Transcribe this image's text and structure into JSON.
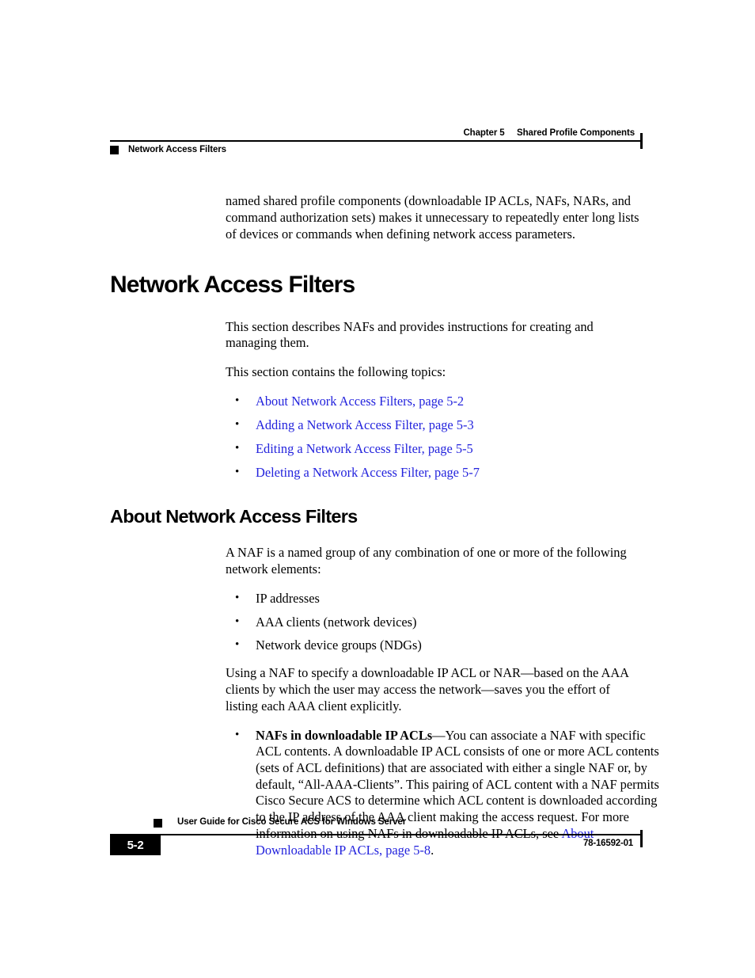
{
  "header": {
    "chapter": "Chapter 5     Shared Profile Components",
    "subtitle": "Network Access Filters"
  },
  "body": {
    "intro_paragraph": "named shared profile components (downloadable IP ACLs, NAFs, NARs, and command authorization sets) makes it unnecessary to repeatedly enter long lists of devices or commands when defining network access parameters.",
    "section_title": "Network Access Filters",
    "section_para_1": "This section describes NAFs and provides instructions for creating and managing them.",
    "section_para_2": "This section contains the following topics:",
    "topic_links": [
      "About Network Access Filters, page 5-2",
      "Adding a Network Access Filter, page 5-3",
      "Editing a Network Access Filter, page 5-5",
      "Deleting a Network Access Filter, page 5-7"
    ],
    "subsection_title": "About Network Access Filters",
    "subsection_para_1": "A NAF is a named group of any combination of one or more of the following network elements:",
    "element_bullets": [
      "IP addresses",
      "AAA clients (network devices)",
      "Network device groups (NDGs)"
    ],
    "subsection_para_2": "Using a NAF to specify a downloadable IP ACL or NAR—based on the AAA clients by which the user may access the network—saves you the effort of listing each AAA client explicitly.",
    "naf_bullet": {
      "bold_lead": "NAFs in downloadable IP ACLs",
      "text_before_link": "—You can associate a NAF with specific ACL contents. A downloadable IP ACL consists of one or more ACL contents (sets of ACL definitions) that are associated with either a single NAF or, by default, “All-AAA-Clients”. This pairing of ACL content with a NAF permits Cisco Secure ACS to determine which ACL content is downloaded according to the IP address of the AAA client making the access request. For more information on using NAFs in downloadable IP ACLs, see ",
      "link_text": "About Downloadable IP ACLs, page 5-8",
      "text_after_link": "."
    }
  },
  "footer": {
    "guide_title": "User Guide for Cisco Secure ACS for Windows Server",
    "page_number": "5-2",
    "doc_number": "78-16592-01"
  },
  "colors": {
    "link": "#2323DD",
    "rule": "#000000",
    "text": "#000000",
    "page_background": "#FFFFFF"
  }
}
